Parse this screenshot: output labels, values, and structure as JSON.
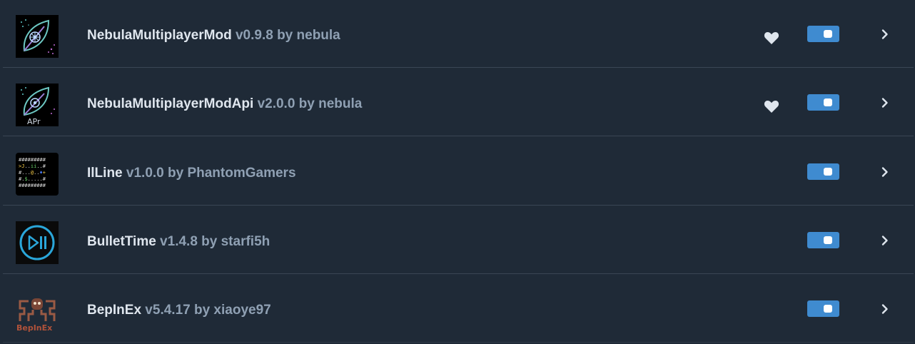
{
  "mods": [
    {
      "name": "NebulaMultiplayerMod",
      "meta": " v0.9.8 by nebula",
      "icon": "nebula-icon",
      "favorite": true,
      "enabled": true
    },
    {
      "name": "NebulaMultiplayerModApi",
      "meta": " v2.0.0 by nebula",
      "icon": "nebula-api-icon",
      "icon_text": "APr",
      "favorite": true,
      "enabled": true
    },
    {
      "name": "IlLine",
      "meta": " v1.0.0 by PhantomGamers",
      "icon": "ascii-grid-icon",
      "favorite": false,
      "enabled": true
    },
    {
      "name": "BulletTime",
      "meta": " v1.4.8 by starfi5h",
      "icon": "play-pause-icon",
      "favorite": false,
      "enabled": true
    },
    {
      "name": "BepInEx",
      "meta": " v5.4.17 by xiaoye97",
      "icon": "bepinex-icon",
      "icon_text": "BepInEx",
      "favorite": false,
      "enabled": true
    }
  ],
  "colors": {
    "background": "#1f2a37",
    "divider": "#3a4654",
    "title": "#dfe6ee",
    "meta": "#8fa0b3",
    "toggle_on": "#3f8bd0",
    "heart": "#dfe6ee",
    "chevron": "#dfe6ee"
  },
  "icons": {
    "favorite": "heart-icon",
    "toggle": "toggle-switch",
    "expand": "chevron-right-icon"
  }
}
